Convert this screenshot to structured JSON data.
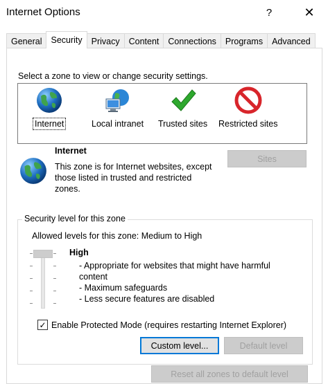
{
  "window": {
    "title": "Internet Options",
    "help_glyph": "?",
    "close_glyph": "✕"
  },
  "tabs": [
    {
      "label": "General"
    },
    {
      "label": "Security",
      "active": true
    },
    {
      "label": "Privacy"
    },
    {
      "label": "Content"
    },
    {
      "label": "Connections"
    },
    {
      "label": "Programs"
    },
    {
      "label": "Advanced"
    }
  ],
  "zones": {
    "prompt": "Select a zone to view or change security settings.",
    "items": [
      {
        "label": "Internet",
        "icon": "globe-icon",
        "selected": true
      },
      {
        "label": "Local intranet",
        "icon": "intranet-icon"
      },
      {
        "label": "Trusted sites",
        "icon": "checkmark-icon"
      },
      {
        "label": "Restricted sites",
        "icon": "restricted-icon"
      }
    ]
  },
  "zone_info": {
    "title": "Internet",
    "description": "This zone is for Internet websites, except those listed in trusted and restricted zones.",
    "sites_label": "Sites"
  },
  "security_level": {
    "group_title": "Security level for this zone",
    "allowed": "Allowed levels for this zone: Medium to High",
    "level_name": "High",
    "bullets": [
      "- Appropriate for websites that might have harmful content",
      "- Maximum safeguards",
      "- Less secure features are disabled"
    ],
    "slider_level": 1.0,
    "protected_mode_label": "Enable Protected Mode (requires restarting Internet Explorer)",
    "protected_mode_checked": true,
    "checkmark_glyph": "✓",
    "custom_level_label": "Custom level...",
    "default_level_label": "Default level"
  },
  "reset_all_label": "Reset all zones to default level",
  "colors": {
    "globe_blue": "#1f6fc2",
    "globe_green": "#3fa34d",
    "check_green": "#2ea82e",
    "restricted_red": "#d8252b",
    "focus_blue": "#0078d7"
  }
}
